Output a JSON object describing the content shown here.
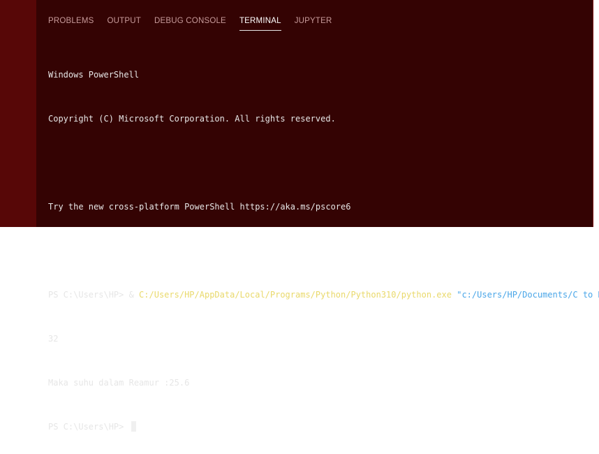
{
  "tabs": [
    {
      "label": "PROBLEMS"
    },
    {
      "label": "OUTPUT"
    },
    {
      "label": "DEBUG CONSOLE"
    },
    {
      "label": "TERMINAL",
      "active": true
    },
    {
      "label": "JUPYTER"
    }
  ],
  "terminal": {
    "line1": "Windows PowerShell",
    "line2": "Copyright (C) Microsoft Corporation. All rights reserved.",
    "line3": "Try the new cross-platform PowerShell https://aka.ms/pscore6",
    "prompt1": "PS C:\\Users\\HP> & ",
    "exe_path": "C:/Users/HP/AppData/Local/Programs/Python/Python310/python.exe",
    "script_arg": "\"c:/Users/HP/Documents/C to R.py\"",
    "output1": "32",
    "output2": "Maka suhu dalam Reamur :25.6",
    "prompt2": "PS C:\\Users\\HP> "
  },
  "colors": {
    "panel_bg": "#340303",
    "frame_bg": "#4a0505",
    "exe_color": "#e9d96b",
    "arg_color": "#4aa6e8"
  }
}
